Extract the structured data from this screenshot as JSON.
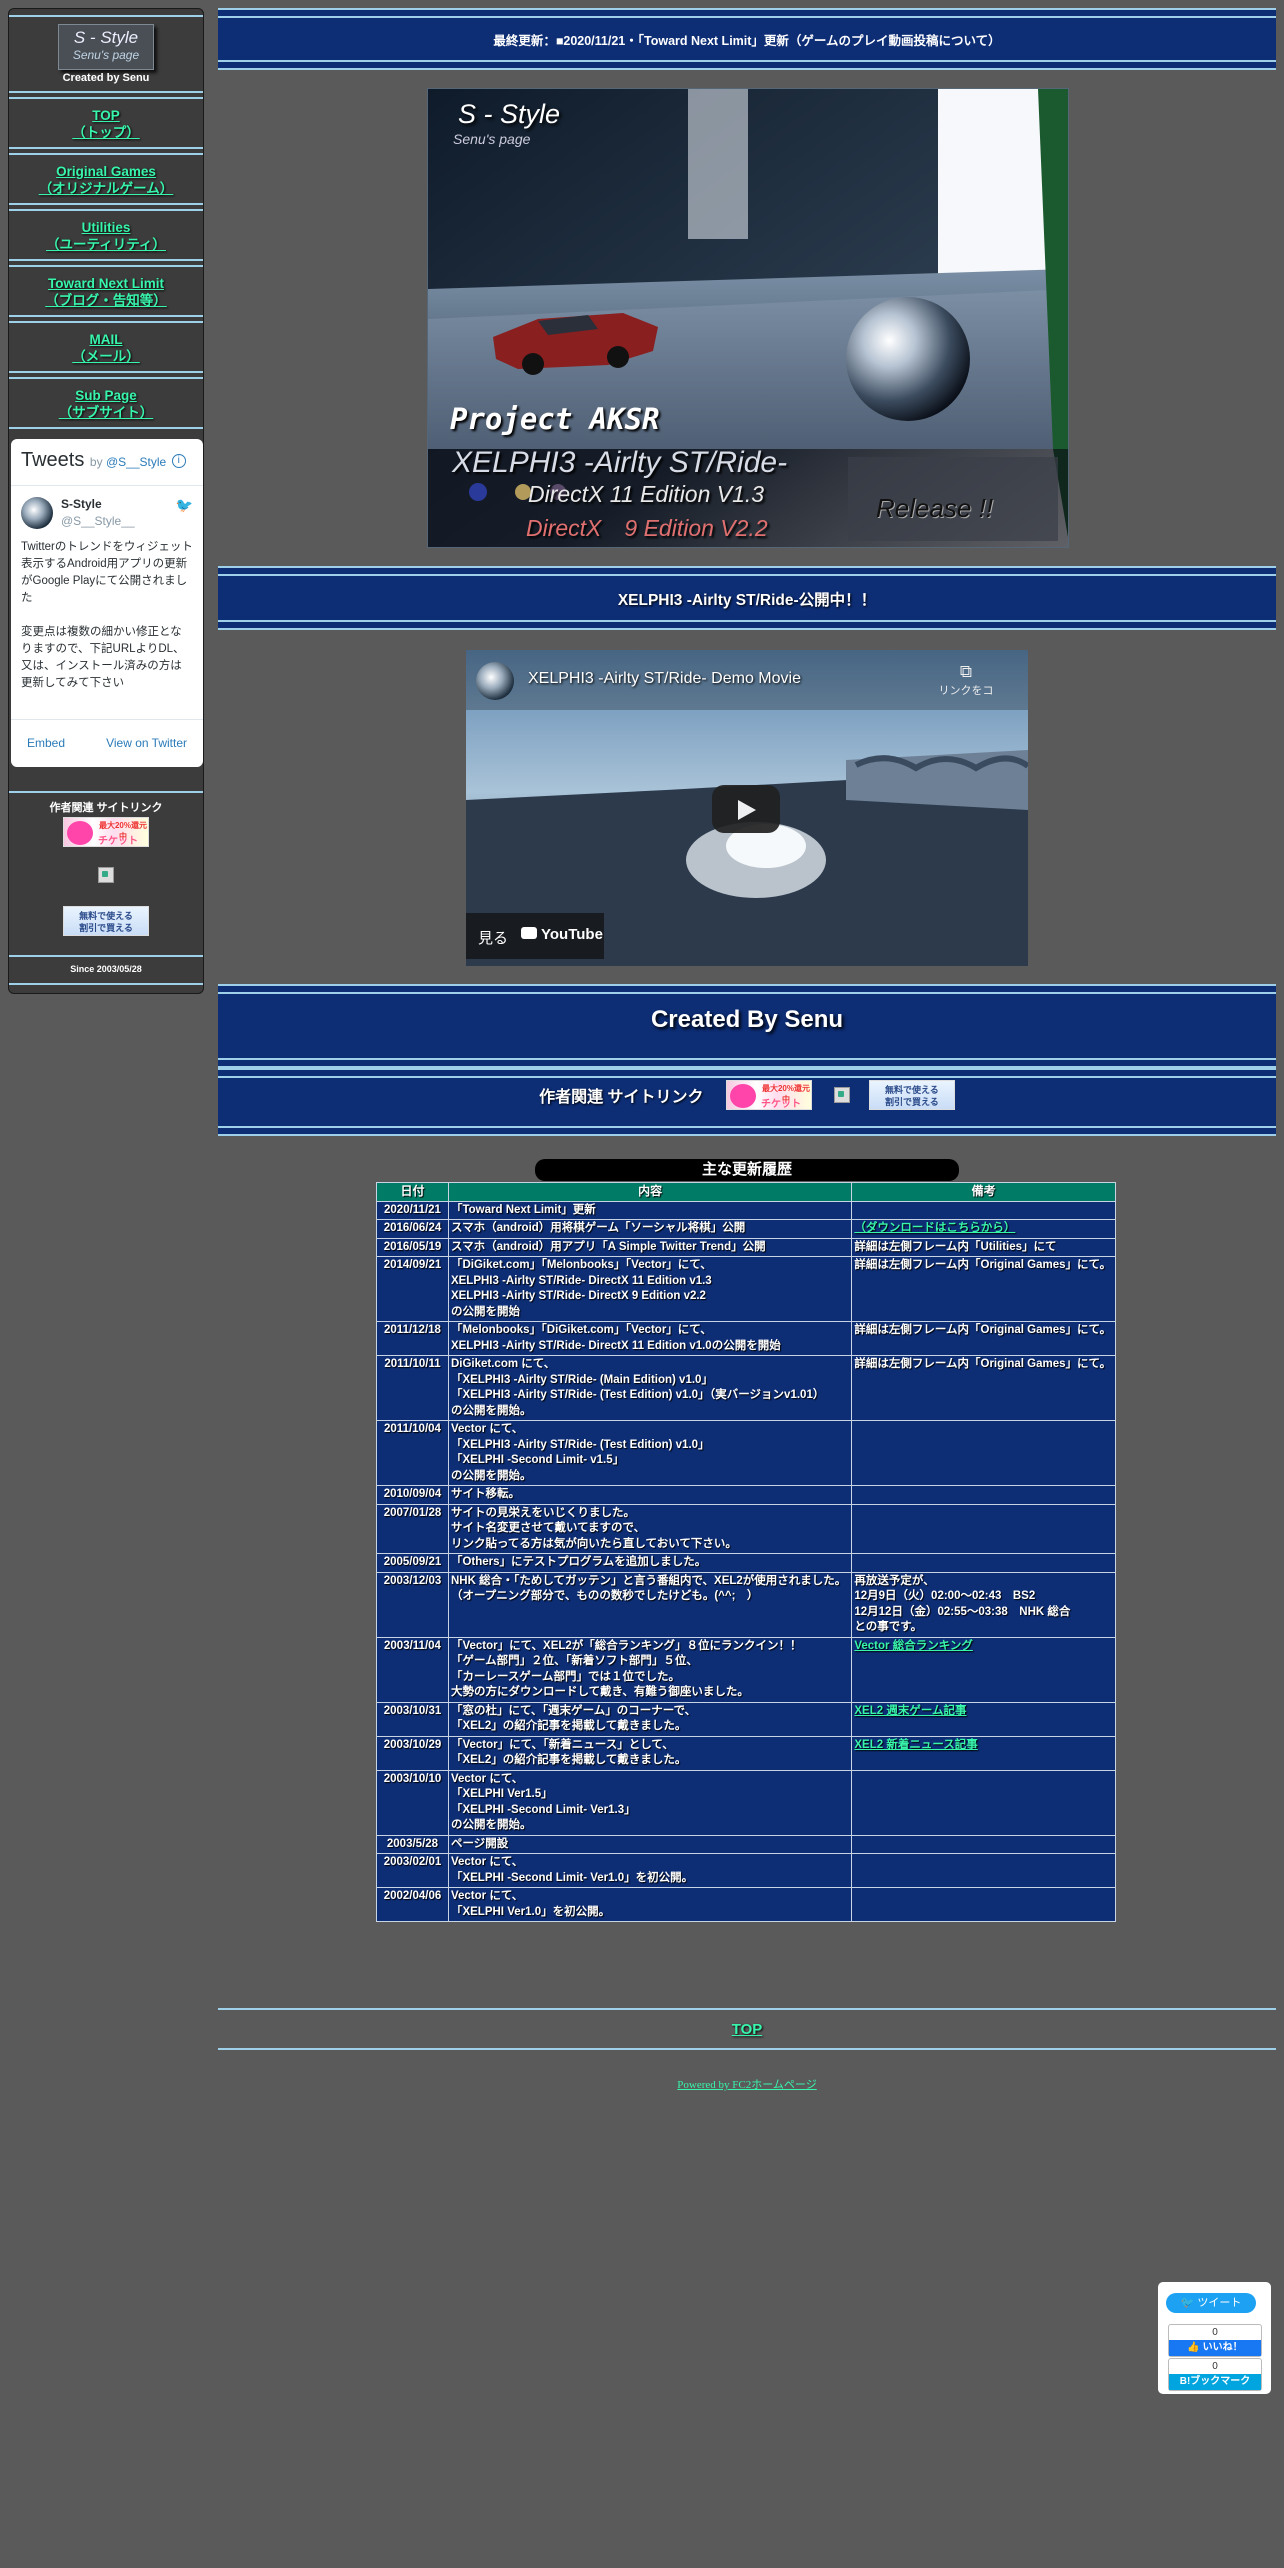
{
  "sidebar": {
    "logo": {
      "title": "S - Style",
      "subtitle": "Senu's page",
      "created": "Created by Senu"
    },
    "nav": [
      {
        "label": "TOP",
        "sub": "（トップ）"
      },
      {
        "label": "Original Games",
        "sub": "（オリジナルゲーム）"
      },
      {
        "label": "Utilities",
        "sub": "（ユーティリティ）"
      },
      {
        "label": "Toward Next Limit",
        "sub": "（ブログ・告知等）"
      },
      {
        "label": "MAIL",
        "sub": "（メール）"
      },
      {
        "label": "Sub Page",
        "sub": "（サブサイト）"
      }
    ],
    "tweets": {
      "title": "Tweets",
      "by": "by",
      "handle_link": "@S__Style",
      "user_name": "S-Style",
      "user_handle": "@S__Style__",
      "text1": "Twitterのトレンドをウィジェット表示するAndroid用アプリの更新がGoogle Playにて公開されました",
      "text2": "変更点は複数の細かい修正となりますので、下記URLよりDL、又は、インストール済みの方は更新してみて下さい",
      "embed": "Embed",
      "view": "View on Twitter"
    },
    "related_title": "作者関連 サイトリンク",
    "banner_ticket": {
      "top": "最大20%還元中",
      "name": "チケット"
    },
    "banner_coupon": {
      "line1": "無料で使える",
      "line2": "割引で買える"
    },
    "since": "Since 2003/05/28"
  },
  "header": {
    "update": "最終更新：■2020/11/21・「Toward Next Limit」更新（ゲームのプレイ動画投稿について）"
  },
  "hero": {
    "logo_title": "S - Style",
    "logo_sub": "Senu's page",
    "project": "Project AKSR",
    "game_title": "XELPHI3 -Airlty ST/Ride-",
    "line_dx11": "DirectX 11 Edition V1.3",
    "line_dx9": "DirectX　9 Edition V2.2",
    "release": "Release !!"
  },
  "announce": "XELPHI3 -Airlty ST/Ride-公開中！！",
  "video": {
    "title": "XELPHI3 -Airlty ST/Ride- Demo Movie",
    "copy": "リンクをコ",
    "watch": "見る",
    "yt": "YouTube"
  },
  "created_by": "Created By Senu",
  "links_label": "作者関連 サイトリンク",
  "history_title": "主な更新履歴",
  "table": {
    "headers": [
      "日付",
      "内容",
      "備考"
    ],
    "rows": [
      {
        "date": "2020/11/21",
        "content": [
          "「Toward Next Limit」更新"
        ],
        "note": []
      },
      {
        "date": "2016/06/24",
        "content": [
          "スマホ（android）用将棋ゲーム「ソーシャル将棋」公開"
        ],
        "note": [],
        "note_link": "（ダウンロードはこちらから）"
      },
      {
        "date": "2016/05/19",
        "content": [
          "スマホ（android）用アプリ「A Simple Twitter Trend」公開"
        ],
        "note": [
          "詳細は左側フレーム内「Utilities」にて"
        ]
      },
      {
        "date": "2014/09/21",
        "content": [
          "「DiGiket.com」「Melonbooks」「Vector」にて、",
          "XELPHI3 -Airlty ST/Ride- DirectX 11 Edition v1.3",
          "XELPHI3 -Airlty ST/Ride- DirectX 9 Edition v2.2",
          "の公開を開始"
        ],
        "note": [
          "詳細は左側フレーム内「Original Games」にて。"
        ]
      },
      {
        "date": "2011/12/18",
        "content": [
          "「Melonbooks」「DiGiket.com」「Vector」にて、",
          "XELPHI3 -Airlty ST/Ride- DirectX 11 Edition v1.0の公開を開始"
        ],
        "note": [
          "詳細は左側フレーム内「Original Games」にて。"
        ]
      },
      {
        "date": "2011/10/11",
        "content": [
          "DiGiket.com にて、",
          "「XELPHI3 -Airlty ST/Ride- (Main Edition) v1.0」",
          "「XELPHI3 -Airlty ST/Ride- (Test Edition) v1.0」（実バージョンv1.01）",
          "の公開を開始。"
        ],
        "note": [
          "詳細は左側フレーム内「Original Games」にて。"
        ]
      },
      {
        "date": "2011/10/04",
        "content": [
          "Vector にて、",
          "「XELPHI3 -Airlty ST/Ride- (Test Edition) v1.0」",
          "「XELPHI -Second Limit- v1.5」",
          "の公開を開始。"
        ],
        "note": []
      },
      {
        "date": "2010/09/04",
        "content": [
          "サイト移転。"
        ],
        "note": []
      },
      {
        "date": "2007/01/28",
        "content": [
          "サイトの見栄えをいじくりました。",
          "サイト名変更させて戴いてますので、",
          "リンク貼ってる方は気が向いたら直しておいて下さい。"
        ],
        "note": []
      },
      {
        "date": "2005/09/21",
        "content": [
          "「Others」にテストプログラムを追加しました。"
        ],
        "note": []
      },
      {
        "date": "2003/12/03",
        "content": [
          "NHK 総合・「ためしてガッテン」と言う番組内で、XEL2が使用されました。",
          "（オープニング部分で、ものの数秒でしたけども。(^^;　）"
        ],
        "note": [
          "再放送予定が、",
          "12月9日（火）02:00～02:43　BS2",
          "12月12日（金）02:55～03:38　NHK 総合",
          "との事です。"
        ]
      },
      {
        "date": "2003/11/04",
        "content": [
          "「Vector」にて、XEL2が「総合ランキング」８位にランクイン！！",
          "「ゲーム部門」２位、「新着ソフト部門」５位、",
          "「カーレースゲーム部門」では１位でした。",
          "大勢の方にダウンロードして戴き、有難う御座いました。"
        ],
        "note": [],
        "note_link": "Vector 総合ランキング"
      },
      {
        "date": "2003/10/31",
        "content": [
          "「窓の杜」にて、「週末ゲーム」のコーナーで、",
          "「XEL2」の紹介記事を掲載して戴きました。"
        ],
        "note": [],
        "note_link": "XEL2 週末ゲーム記事"
      },
      {
        "date": "2003/10/29",
        "content": [
          "「Vector」にて、「新着ニュース」として、",
          "「XEL2」の紹介記事を掲載して戴きました。"
        ],
        "note": [],
        "note_link": "XEL2 新着ニュース記事"
      },
      {
        "date": "2003/10/10",
        "content": [
          "Vector にて、",
          "「XELPHI Ver1.5」",
          "「XELPHI -Second Limit- Ver1.3」",
          "の公開を開始。"
        ],
        "note": []
      },
      {
        "date": "2003/5/28",
        "content": [
          "ページ開設"
        ],
        "note": []
      },
      {
        "date": "2003/02/01",
        "content": [
          "Vector にて、",
          "「XELPHI -Second Limit- Ver1.0」を初公開。"
        ],
        "note": []
      },
      {
        "date": "2002/04/06",
        "content": [
          "Vector にて、",
          "「XELPHI Ver1.0」を初公開。"
        ],
        "note": []
      }
    ]
  },
  "footer": {
    "top": "TOP",
    "powered": "Powered by FC2ホームページ"
  },
  "share": {
    "tweet": "ツイート",
    "like_count": "0",
    "like": "いいね！",
    "hatena_count": "0",
    "hatena": "B!ブックマーク"
  }
}
